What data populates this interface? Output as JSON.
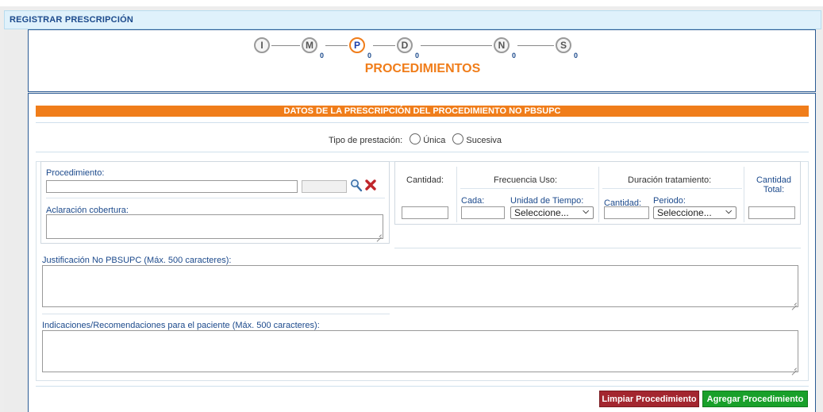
{
  "header": {
    "title": "REGISTRAR PRESCRIPCIÓN"
  },
  "steps": {
    "items": [
      {
        "letter": "I",
        "count": ""
      },
      {
        "letter": "M",
        "count": "0"
      },
      {
        "letter": "P",
        "count": "0",
        "active": true
      },
      {
        "letter": "D",
        "count": "0"
      },
      {
        "letter": "N",
        "count": "0"
      },
      {
        "letter": "S",
        "count": "0"
      }
    ],
    "current_title": "PROCEDIMIENTOS"
  },
  "section": {
    "title": "DATOS DE LA PRESCRIPCIÓN DEL PROCEDIMIENTO NO PBSUPC"
  },
  "tipo_prestacion": {
    "label": "Tipo de prestación:",
    "options": [
      "Única",
      "Sucesiva"
    ]
  },
  "procedimiento": {
    "label": "Procedimiento:",
    "value": "",
    "code_value": "",
    "aclaracion_label": "Aclaración cobertura:",
    "aclaracion_value": ""
  },
  "frecuencia": {
    "cantidad_label": "Cantidad:",
    "frecuencia_label": "Frecuencia Uso:",
    "cada_label": "Cada:",
    "unidad_label": "Unidad de Tiempo:",
    "unidad_selected": "Seleccione...",
    "duracion_label": "Duración tratamiento:",
    "duracion_cantidad_label": "Cantidad:",
    "periodo_label": "Periodo:",
    "periodo_selected": "Seleccione...",
    "cantidad_total_label": "Cantidad Total:"
  },
  "justificacion": {
    "label": "Justificación No PBSUPC (Máx. 500 caracteres):",
    "value": ""
  },
  "indicaciones": {
    "label": "Indicaciones/Recomendaciones para el paciente (Máx. 500 caracteres):",
    "value": ""
  },
  "buttons": {
    "limpiar": "Limpiar Procedimiento",
    "agregar": "Agregar Procedimiento"
  },
  "colors": {
    "accent_orange": "#f07d1a",
    "header_blue": "#1c4a8c",
    "panel_border": "#2c5b94",
    "clear_red": "#a3262f",
    "add_green": "#19a02a"
  },
  "icons": [
    "search-icon",
    "delete-x-icon",
    "chevron-down-icon",
    "resize-grip-icon"
  ]
}
